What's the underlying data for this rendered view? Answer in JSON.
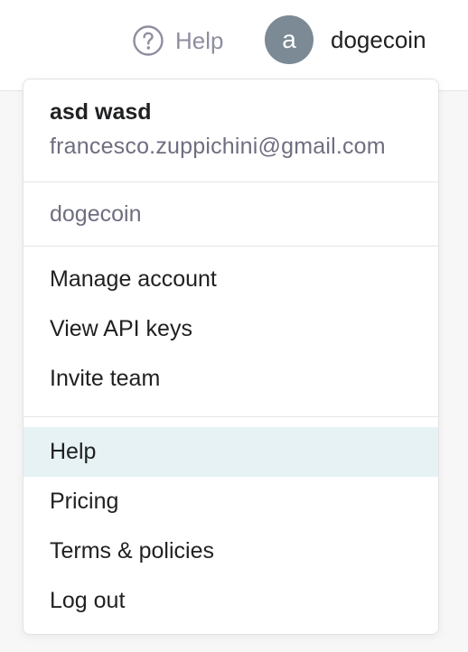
{
  "topbar": {
    "help_label": "Help",
    "avatar_initial": "a",
    "account_name": "dogecoin"
  },
  "dropdown": {
    "user_name": "asd wasd",
    "user_email": "francesco.zuppichini@gmail.com",
    "org_name": "dogecoin",
    "account_items": [
      "Manage account",
      "View API keys",
      "Invite team"
    ],
    "support_items": [
      "Help",
      "Pricing",
      "Terms & policies",
      "Log out"
    ],
    "highlighted_item": "Help"
  },
  "colors": {
    "avatar_bg": "#7b8a94",
    "highlight_bg": "#e6f2f3",
    "muted_text": "#6e6e80",
    "help_icon": "#8e8ea0"
  },
  "icons": {
    "help": "question-circle-icon"
  }
}
